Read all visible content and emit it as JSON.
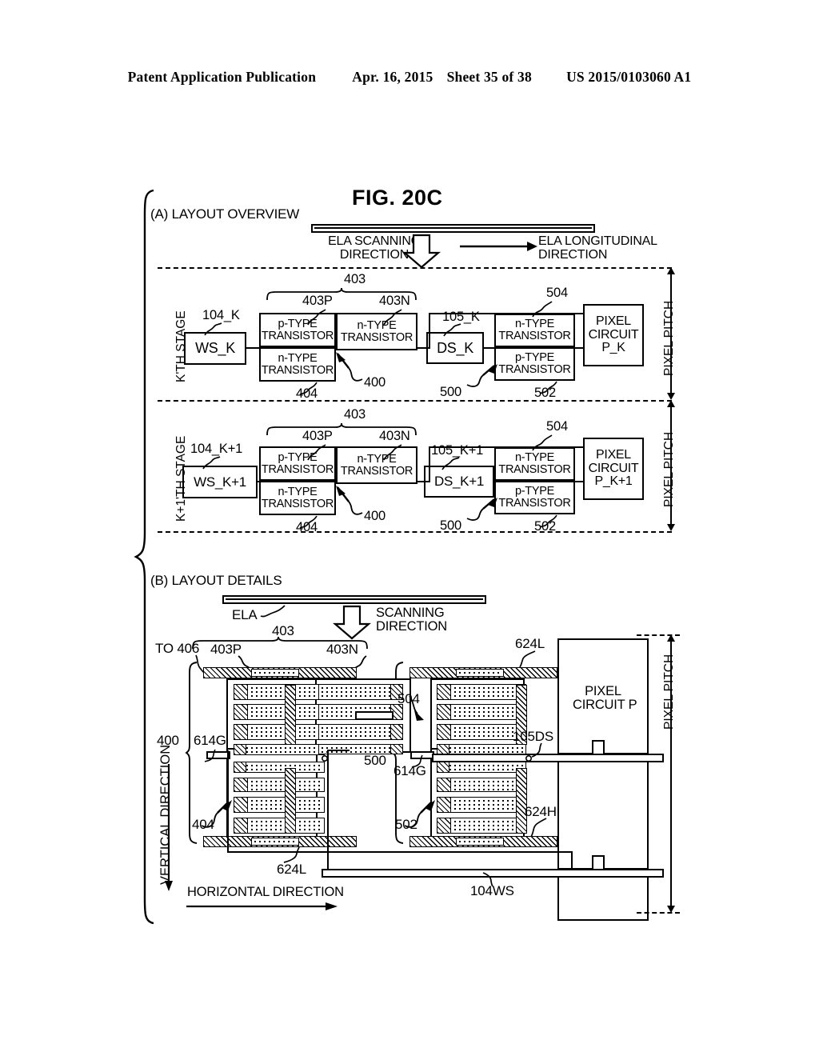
{
  "header": {
    "publication": "Patent Application Publication",
    "date": "Apr. 16, 2015",
    "sheet": "Sheet 35 of 38",
    "docnum": "US 2015/0103060 A1"
  },
  "figure": {
    "title": "FIG. 20C",
    "sections": [
      {
        "key": "a",
        "label": "(A) LAYOUT OVERVIEW"
      },
      {
        "key": "b",
        "label": "(B) LAYOUT DETAILS"
      }
    ]
  },
  "section_a": {
    "ela_scanning_direction": "ELA SCANNING\nDIRECTION",
    "ela_scanning_line1": "ELA SCANNING",
    "ela_scanning_line2": "DIRECTION",
    "ela_longitudinal_line1": "ELA LONGITUDINAL",
    "ela_longitudinal_line2": "DIRECTION",
    "pixel_pitch": "PIXEL PITCH",
    "stage_k": {
      "stage_label": "K'TH STAGE",
      "ws_ref": "104_K",
      "ws_label": "WS_K",
      "group_403": "403",
      "ref_403p": "403P",
      "ref_403n": "403N",
      "ref_404": "404",
      "ref_400": "400",
      "p_type_top": "p-TYPE\nTRANSISTOR",
      "p_type_l1": "p-TYPE",
      "p_type_l2": "TRANSISTOR",
      "n_type_l1": "n-TYPE",
      "n_type_l2": "TRANSISTOR",
      "ds_ref": "105_K",
      "ds_label": "DS_K",
      "ref_504": "504",
      "ref_502": "502",
      "ref_500": "500",
      "pixel_circuit_l1": "PIXEL",
      "pixel_circuit_l2": "CIRCUIT",
      "pixel_circuit_l3": "P_K"
    },
    "stage_k1": {
      "stage_label": "K+1'TH STAGE",
      "ws_ref": "104_K+1",
      "ws_label": "WS_K+1",
      "group_403": "403",
      "ref_403p": "403P",
      "ref_403n": "403N",
      "ref_404": "404",
      "ref_400": "400",
      "p_type_l1": "p-TYPE",
      "p_type_l2": "TRANSISTOR",
      "n_type_l1": "n-TYPE",
      "n_type_l2": "TRANSISTOR",
      "ds_ref": "105_K+1",
      "ds_label": "DS_K+1",
      "ref_504": "504",
      "ref_502": "502",
      "ref_500": "500",
      "pixel_circuit_l1": "PIXEL",
      "pixel_circuit_l2": "CIRCUIT",
      "pixel_circuit_l3": "P_K+1"
    }
  },
  "section_b": {
    "ela_label": "ELA",
    "scanning_l1": "SCANNING",
    "scanning_l2": "DIRECTION",
    "to_406": "TO 406",
    "group_403": "403",
    "ref_403p": "403P",
    "ref_403n": "403N",
    "ref_400": "400",
    "ref_404": "404",
    "ref_614g_left": "614G",
    "ref_614g_right": "614G",
    "ref_500": "500",
    "ref_502": "502",
    "ref_504": "504",
    "ref_624l_top": "624L",
    "ref_624l_bottom": "624L",
    "ref_624h": "624H",
    "ref_105ds": "105DS",
    "ref_104ws": "104WS",
    "pixel_circuit_l1": "PIXEL",
    "pixel_circuit_l2": "CIRCUIT P",
    "pixel_pitch": "PIXEL PITCH",
    "vertical_direction": "VERTICAL DIRECTION",
    "horizontal_direction": "HORIZONTAL DIRECTION"
  },
  "colors": {
    "ink": "#000000",
    "paper": "#ffffff"
  }
}
